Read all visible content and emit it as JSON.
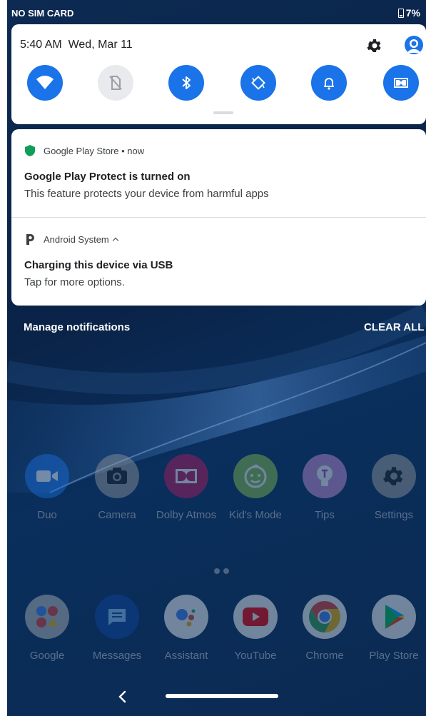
{
  "status_bar": {
    "carrier": "NO SIM CARD",
    "battery_percent": "7%",
    "battery_icon": "battery-icon"
  },
  "quick_settings": {
    "time_date": "5:40 AM  Wed, Mar 11",
    "settings_icon": "gear-icon",
    "account_icon": "user-icon",
    "tiles": [
      {
        "name": "wifi",
        "state": "on"
      },
      {
        "name": "mobile-data",
        "state": "off"
      },
      {
        "name": "bluetooth",
        "state": "on"
      },
      {
        "name": "auto-rotate",
        "state": "on"
      },
      {
        "name": "sound",
        "state": "on"
      },
      {
        "name": "dolby",
        "state": "on"
      }
    ],
    "accent_color": "#1a73e8"
  },
  "notifications": [
    {
      "app": "Google Play Store • now",
      "title": "Google Play Protect is turned on",
      "text": "This feature protects your device from harmful apps",
      "icon": "shield-icon",
      "icon_color": "#0f9d58"
    },
    {
      "app": "Android System",
      "title": "Charging this device via USB",
      "text": "Tap for more options.",
      "icon": "android-system-icon"
    }
  ],
  "actions": {
    "manage": "Manage notifications",
    "clear_all": "CLEAR ALL"
  },
  "home": {
    "row1": [
      {
        "label": "Duo",
        "icon": "video-camera-icon",
        "color": "#1a73e8"
      },
      {
        "label": "Camera",
        "icon": "camera-icon",
        "color": "#5f6368"
      },
      {
        "label": "Dolby Atmos",
        "icon": "dolby-icon",
        "color": "#c2185b"
      },
      {
        "label": "Kid's Mode",
        "icon": "kid-face-icon",
        "color": "#7cb342"
      },
      {
        "label": "Tips",
        "icon": "lightbulb-icon",
        "color": "#ab47bc"
      },
      {
        "label": "Settings",
        "icon": "gear-icon",
        "color": "#757575"
      }
    ],
    "row2": [
      {
        "label": "Google",
        "icon": "google-folder-icon",
        "color": "#9e9e9e"
      },
      {
        "label": "Messages",
        "icon": "messages-icon",
        "color": "#1e88e5"
      },
      {
        "label": "Assistant",
        "icon": "assistant-icon",
        "color": "#ffffff"
      },
      {
        "label": "YouTube",
        "icon": "youtube-icon",
        "color": "#ffffff"
      },
      {
        "label": "Chrome",
        "icon": "chrome-icon",
        "color": "#ffffff"
      },
      {
        "label": "Play Store",
        "icon": "play-store-icon",
        "color": "#ffffff"
      }
    ]
  },
  "nav": {
    "back_icon": "back-chevron-icon",
    "home_icon": "home-pill-icon"
  }
}
